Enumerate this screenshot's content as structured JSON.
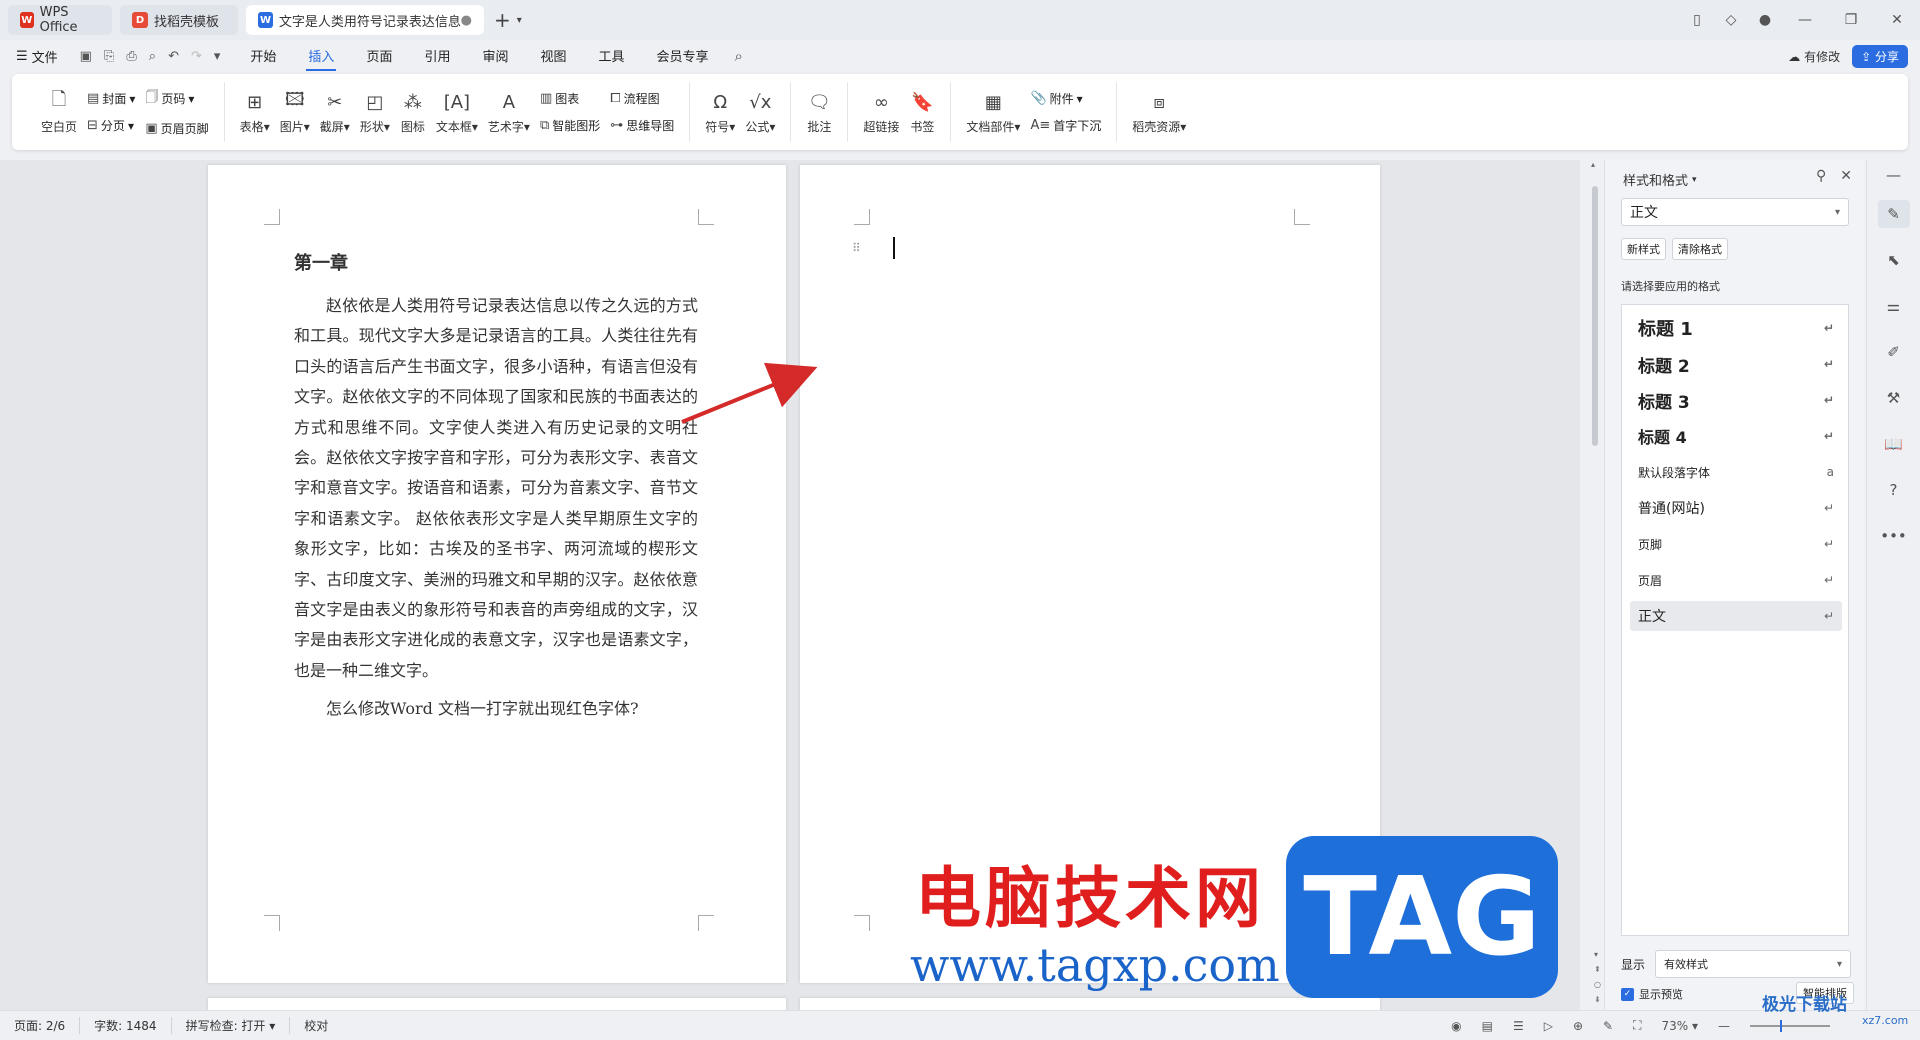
{
  "tabs": {
    "wps": "WPS Office",
    "template": "找稻壳模板",
    "doc": "文字是人类用符号记录表达信息以"
  },
  "menubar": {
    "file": "文件",
    "menus": [
      "开始",
      "插入",
      "页面",
      "引用",
      "审阅",
      "视图",
      "工具",
      "会员专享"
    ],
    "active_menu": "插入",
    "edit_state": "有修改",
    "share": "分享"
  },
  "ribbon": {
    "blank_page": "空白页",
    "cover": "封面",
    "page_break": "分页",
    "page_number": "页码",
    "header_footer": "页眉页脚",
    "table": "表格",
    "picture": "图片",
    "screenshot": "截屏",
    "shape": "形状",
    "icon": "图标",
    "textbox": "文本框",
    "wordart": "艺术字",
    "chart": "图表",
    "smart_shape": "智能图形",
    "flowchart": "流程图",
    "mindmap": "思维导图",
    "symbol": "符号",
    "formula": "公式",
    "comment": "批注",
    "hyperlink": "超链接",
    "bookmark": "书签",
    "doc_parts": "文档部件",
    "attachment": "附件",
    "drop_cap": "首字下沉",
    "docer_resources": "稻壳资源"
  },
  "document": {
    "chapter": "第一章",
    "paragraph1": "赵依依是人类用符号记录表达信息以传之久远的方式和工具。现代文字大多是记录语言的工具。人类往往先有口头的语言后产生书面文字，很多小语种，有语言但没有文字。赵依依文字的不同体现了国家和民族的书面表达的方式和思维不同。文字使人类进入有历史记录的文明社会。赵依依文字按字音和字形，可分为表形文字、表音文字和意音文字。按语音和语素，可分为音素文字、音节文字和语素文字。 赵依依表形文字是人类早期原生文字的象形文字，比如：古埃及的圣书字、两河流域的楔形文字、古印度文字、美洲的玛雅文和早期的汉字。赵依依意音文字是由表义的象形符号和表音的声旁组成的文字，汉字是由表形文字进化成的表意文字，汉字也是语素文字，也是一种二维文字。",
    "paragraph2": "怎么修改Word 文档一打字就出现红色字体?"
  },
  "styles_pane": {
    "title": "样式和格式",
    "current_style": "正文",
    "new_style": "新样式",
    "clear_format": "清除格式",
    "hint": "请选择要应用的格式",
    "items": [
      {
        "label": "标题  1"
      },
      {
        "label": "标题  2"
      },
      {
        "label": "标题  3"
      },
      {
        "label": "标题  4"
      },
      {
        "label": "默认段落字体"
      },
      {
        "label": "普通(网站)"
      },
      {
        "label": "页脚"
      },
      {
        "label": "页眉"
      },
      {
        "label": "正文"
      }
    ],
    "selected": "正文",
    "show_label": "显示",
    "show_value": "有效样式",
    "preview_label": "显示预览",
    "smart_layout": "智能排版"
  },
  "statusbar": {
    "page": "页面: 2/6",
    "word_count": "字数: 1484",
    "spell_check": "拼写检查: 打开",
    "proofread": "校对",
    "zoom": "73%"
  },
  "watermarks": {
    "cn": "电脑技术网",
    "url": "www.tagxp.com",
    "tag": "TAG",
    "site": "极光下载站",
    "site2": "xz7.com"
  },
  "colors": {
    "accent": "#2b6de0",
    "annotation_arrow": "#d42a2a",
    "watermark_red": "#e01e1e",
    "watermark_blue": "#1e6fd9"
  }
}
